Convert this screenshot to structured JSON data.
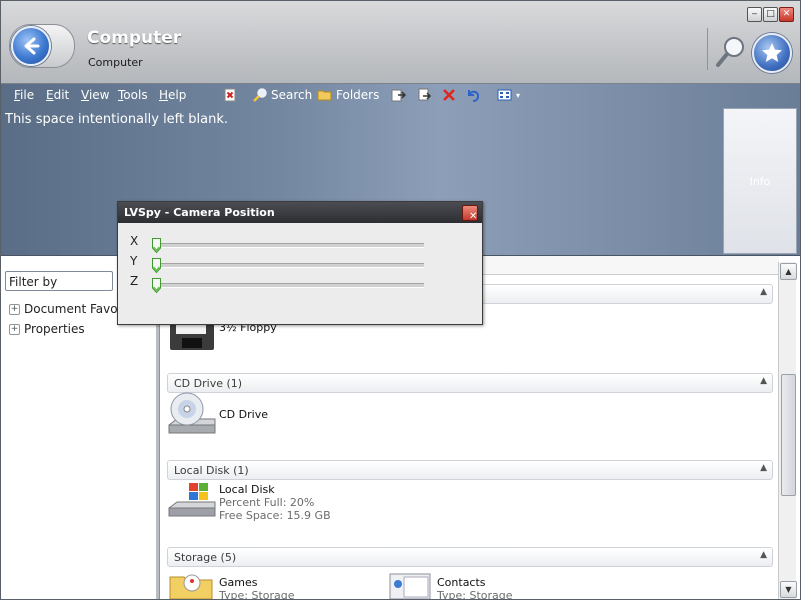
{
  "window": {
    "title": "Computer",
    "subtitle": "Computer"
  },
  "window_controls": [
    "minimize",
    "maximize",
    "close"
  ],
  "menu": [
    {
      "label": "File",
      "accel": "F",
      "rest": "ile"
    },
    {
      "label": "Edit",
      "accel": "E",
      "rest": "dit"
    },
    {
      "label": "View",
      "accel": "V",
      "rest": "iew"
    },
    {
      "label": "Tools",
      "accel": "T",
      "rest": "ools"
    },
    {
      "label": "Help",
      "accel": "H",
      "rest": "elp"
    }
  ],
  "toolbar": {
    "search_label": "Search",
    "folders_label": "Folders"
  },
  "banner": {
    "text": "This space intentionally left blank.",
    "info_label": "Info"
  },
  "left_pane": {
    "filter_placeholder": "Filter by",
    "tree": [
      "Document Favorites",
      "Properties"
    ]
  },
  "groups": [
    {
      "label": "",
      "items": [
        {
          "name": "3½ Floppy"
        }
      ]
    },
    {
      "label": "CD Drive (1)",
      "items": [
        {
          "name": "CD Drive"
        }
      ]
    },
    {
      "label": "Local Disk (1)",
      "items": [
        {
          "name": "Local Disk",
          "details": [
            "Percent Full: 20%",
            "Free Space: 15.9 GB"
          ]
        }
      ]
    },
    {
      "label": "Storage (5)",
      "items": [
        {
          "name": "Games",
          "details": [
            "Type: Storage"
          ]
        },
        {
          "name": "Contacts",
          "details": [
            "Type: Storage"
          ]
        }
      ]
    }
  ],
  "dialog": {
    "title": "LVSpy - Camera Position",
    "axes": [
      {
        "label": "X",
        "value": 0.0
      },
      {
        "label": "Y",
        "value": 0.0
      },
      {
        "label": "Z",
        "value": 0.0
      }
    ]
  },
  "colors": {
    "banner": "#7487a1",
    "accent_blue": "#3d78d0",
    "close_red": "#c8372a"
  }
}
